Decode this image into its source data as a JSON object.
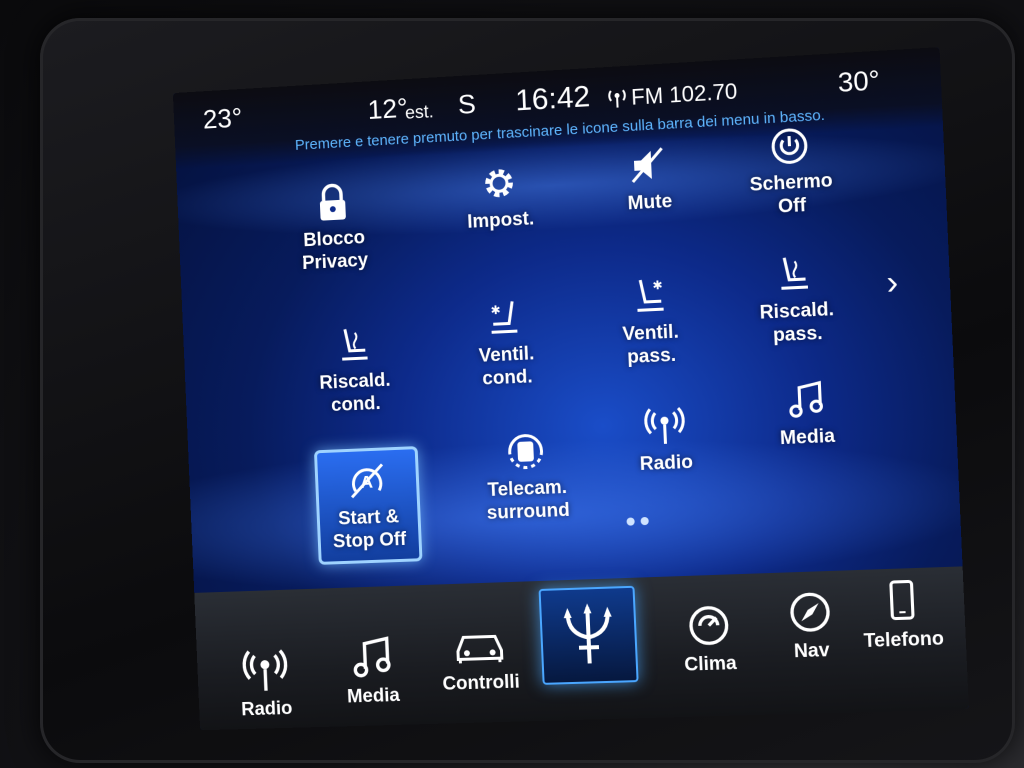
{
  "status": {
    "temp_left": "23°",
    "temp_outside": "12°",
    "temp_outside_suffix": "est.",
    "heading": "S",
    "clock": "16:42",
    "radio": "FM 102.70",
    "temp_right": "30°"
  },
  "hint": "Premere e tenere premuto per trascinare le icone sulla barra dei menu in basso.",
  "grid": [
    {
      "label_1": "Blocco",
      "label_2": "Privacy",
      "icon": "lock-icon"
    },
    {
      "label_1": "Impost.",
      "label_2": "",
      "icon": "gear-icon"
    },
    {
      "label_1": "Mute",
      "label_2": "",
      "icon": "mute-icon"
    },
    {
      "label_1": "Schermo",
      "label_2": "Off",
      "icon": "power-icon"
    },
    {
      "label_1": "Riscald.",
      "label_2": "cond.",
      "icon": "heated-seat-icon"
    },
    {
      "label_1": "Ventil.",
      "label_2": "cond.",
      "icon": "ventilated-seat-icon"
    },
    {
      "label_1": "Ventil.",
      "label_2": "pass.",
      "icon": "ventilated-seat-icon"
    },
    {
      "label_1": "Riscald.",
      "label_2": "pass.",
      "icon": "heated-seat-icon"
    },
    {
      "label_1": "Start &",
      "label_2": "Stop Off",
      "icon": "start-stop-off-icon",
      "selected": true
    },
    {
      "label_1": "Telecam.",
      "label_2": "surround",
      "icon": "surround-camera-icon"
    },
    {
      "label_1": "Radio",
      "label_2": "",
      "icon": "radio-icon"
    },
    {
      "label_1": "Media",
      "label_2": "",
      "icon": "music-note-icon"
    }
  ],
  "bottom_bar": [
    {
      "label": "Radio",
      "icon": "radio-icon"
    },
    {
      "label": "Media",
      "icon": "music-note-icon"
    },
    {
      "label": "Controlli",
      "icon": "car-icon"
    },
    {
      "label": "",
      "icon": "trident-logo-icon"
    },
    {
      "label": "Clima",
      "icon": "climate-icon"
    },
    {
      "label": "Nav",
      "icon": "compass-icon"
    },
    {
      "label": "Telefono",
      "icon": "phone-icon"
    }
  ],
  "pager": {
    "pages": 2
  },
  "colors": {
    "accent": "#4aa6ff",
    "hint_text": "#5fb6ff",
    "background": "#0d2a8a"
  }
}
